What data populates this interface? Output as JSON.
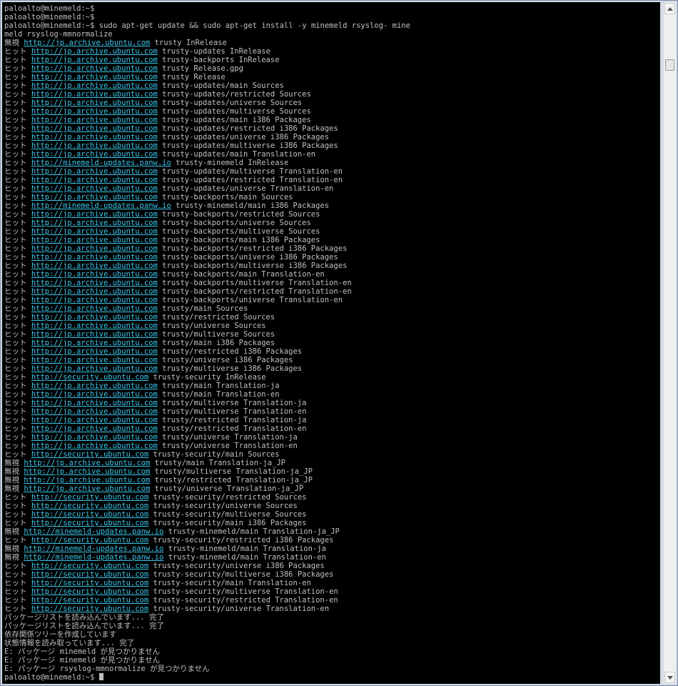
{
  "colors": {
    "background": "#000000",
    "text": "#c0c0c0",
    "link": "#39c6ea"
  },
  "terminal": {
    "lines": [
      {
        "text": "paloalto@minemeld:~$"
      },
      {
        "text": "paloalto@minemeld:~$"
      },
      {
        "text": "paloalto@minemeld:~$ sudo apt-get update && sudo apt-get install -y minemeld rsyslog- mine"
      },
      {
        "text": "meld rsyslog-mmnormalize"
      },
      {
        "pre": "無視 ",
        "url": "http://jp.archive.ubuntu.com",
        "post": " trusty InRelease"
      },
      {
        "pre": "ヒット ",
        "url": "http://jp.archive.ubuntu.com",
        "post": " trusty-updates InRelease"
      },
      {
        "pre": "ヒット ",
        "url": "http://jp.archive.ubuntu.com",
        "post": " trusty-backports InRelease"
      },
      {
        "pre": "ヒット ",
        "url": "http://jp.archive.ubuntu.com",
        "post": " trusty Release.gpg"
      },
      {
        "pre": "ヒット ",
        "url": "http://jp.archive.ubuntu.com",
        "post": " trusty Release"
      },
      {
        "pre": "ヒット ",
        "url": "http://jp.archive.ubuntu.com",
        "post": " trusty-updates/main Sources"
      },
      {
        "pre": "ヒット ",
        "url": "http://jp.archive.ubuntu.com",
        "post": " trusty-updates/restricted Sources"
      },
      {
        "pre": "ヒット ",
        "url": "http://jp.archive.ubuntu.com",
        "post": " trusty-updates/universe Sources"
      },
      {
        "pre": "ヒット ",
        "url": "http://jp.archive.ubuntu.com",
        "post": " trusty-updates/multiverse Sources"
      },
      {
        "pre": "ヒット ",
        "url": "http://jp.archive.ubuntu.com",
        "post": " trusty-updates/main i386 Packages"
      },
      {
        "pre": "ヒット ",
        "url": "http://jp.archive.ubuntu.com",
        "post": " trusty-updates/restricted i386 Packages"
      },
      {
        "pre": "ヒット ",
        "url": "http://jp.archive.ubuntu.com",
        "post": " trusty-updates/universe i386 Packages"
      },
      {
        "pre": "ヒット ",
        "url": "http://jp.archive.ubuntu.com",
        "post": " trusty-updates/multiverse i386 Packages"
      },
      {
        "pre": "ヒット ",
        "url": "http://jp.archive.ubuntu.com",
        "post": " trusty-updates/main Translation-en"
      },
      {
        "pre": "ヒット ",
        "url": "http://minemeld-updates.panw.io",
        "post": " trusty-minemeld InRelease"
      },
      {
        "pre": "ヒット ",
        "url": "http://jp.archive.ubuntu.com",
        "post": " trusty-updates/multiverse Translation-en"
      },
      {
        "pre": "ヒット ",
        "url": "http://jp.archive.ubuntu.com",
        "post": " trusty-updates/restricted Translation-en"
      },
      {
        "pre": "ヒット ",
        "url": "http://jp.archive.ubuntu.com",
        "post": " trusty-updates/universe Translation-en"
      },
      {
        "pre": "ヒット ",
        "url": "http://jp.archive.ubuntu.com",
        "post": " trusty-backports/main Sources"
      },
      {
        "pre": "ヒット ",
        "url": "http://minemeld-updates.panw.io",
        "post": " trusty-minemeld/main i386 Packages"
      },
      {
        "pre": "ヒット ",
        "url": "http://jp.archive.ubuntu.com",
        "post": " trusty-backports/restricted Sources"
      },
      {
        "pre": "ヒット ",
        "url": "http://jp.archive.ubuntu.com",
        "post": " trusty-backports/universe Sources"
      },
      {
        "pre": "ヒット ",
        "url": "http://jp.archive.ubuntu.com",
        "post": " trusty-backports/multiverse Sources"
      },
      {
        "pre": "ヒット ",
        "url": "http://jp.archive.ubuntu.com",
        "post": " trusty-backports/main i386 Packages"
      },
      {
        "pre": "ヒット ",
        "url": "http://jp.archive.ubuntu.com",
        "post": " trusty-backports/restricted i386 Packages"
      },
      {
        "pre": "ヒット ",
        "url": "http://jp.archive.ubuntu.com",
        "post": " trusty-backports/universe i386 Packages"
      },
      {
        "pre": "ヒット ",
        "url": "http://jp.archive.ubuntu.com",
        "post": " trusty-backports/multiverse i386 Packages"
      },
      {
        "pre": "ヒット ",
        "url": "http://jp.archive.ubuntu.com",
        "post": " trusty-backports/main Translation-en"
      },
      {
        "pre": "ヒット ",
        "url": "http://jp.archive.ubuntu.com",
        "post": " trusty-backports/multiverse Translation-en"
      },
      {
        "pre": "ヒット ",
        "url": "http://jp.archive.ubuntu.com",
        "post": " trusty-backports/restricted Translation-en"
      },
      {
        "pre": "ヒット ",
        "url": "http://jp.archive.ubuntu.com",
        "post": " trusty-backports/universe Translation-en"
      },
      {
        "pre": "ヒット ",
        "url": "http://jp.archive.ubuntu.com",
        "post": " trusty/main Sources"
      },
      {
        "pre": "ヒット ",
        "url": "http://jp.archive.ubuntu.com",
        "post": " trusty/restricted Sources"
      },
      {
        "pre": "ヒット ",
        "url": "http://jp.archive.ubuntu.com",
        "post": " trusty/universe Sources"
      },
      {
        "pre": "ヒット ",
        "url": "http://jp.archive.ubuntu.com",
        "post": " trusty/multiverse Sources"
      },
      {
        "pre": "ヒット ",
        "url": "http://jp.archive.ubuntu.com",
        "post": " trusty/main i386 Packages"
      },
      {
        "pre": "ヒット ",
        "url": "http://jp.archive.ubuntu.com",
        "post": " trusty/restricted i386 Packages"
      },
      {
        "pre": "ヒット ",
        "url": "http://jp.archive.ubuntu.com",
        "post": " trusty/universe i386 Packages"
      },
      {
        "pre": "ヒット ",
        "url": "http://jp.archive.ubuntu.com",
        "post": " trusty/multiverse i386 Packages"
      },
      {
        "pre": "ヒット ",
        "url": "http://security.ubuntu.com",
        "post": " trusty-security InRelease"
      },
      {
        "pre": "ヒット ",
        "url": "http://jp.archive.ubuntu.com",
        "post": " trusty/main Translation-ja"
      },
      {
        "pre": "ヒット ",
        "url": "http://jp.archive.ubuntu.com",
        "post": " trusty/main Translation-en"
      },
      {
        "pre": "ヒット ",
        "url": "http://jp.archive.ubuntu.com",
        "post": " trusty/multiverse Translation-ja"
      },
      {
        "pre": "ヒット ",
        "url": "http://jp.archive.ubuntu.com",
        "post": " trusty/multiverse Translation-en"
      },
      {
        "pre": "ヒット ",
        "url": "http://jp.archive.ubuntu.com",
        "post": " trusty/restricted Translation-ja"
      },
      {
        "pre": "ヒット ",
        "url": "http://jp.archive.ubuntu.com",
        "post": " trusty/restricted Translation-en"
      },
      {
        "pre": "ヒット ",
        "url": "http://jp.archive.ubuntu.com",
        "post": " trusty/universe Translation-ja"
      },
      {
        "pre": "ヒット ",
        "url": "http://jp.archive.ubuntu.com",
        "post": " trusty/universe Translation-en"
      },
      {
        "pre": "ヒット ",
        "url": "http://security.ubuntu.com",
        "post": " trusty-security/main Sources"
      },
      {
        "pre": "無視 ",
        "url": "http://jp.archive.ubuntu.com",
        "post": " trusty/main Translation-ja_JP"
      },
      {
        "pre": "無視 ",
        "url": "http://jp.archive.ubuntu.com",
        "post": " trusty/multiverse Translation-ja_JP"
      },
      {
        "pre": "無視 ",
        "url": "http://jp.archive.ubuntu.com",
        "post": " trusty/restricted Translation-ja_JP"
      },
      {
        "pre": "無視 ",
        "url": "http://jp.archive.ubuntu.com",
        "post": " trusty/universe Translation-ja_JP"
      },
      {
        "pre": "ヒット ",
        "url": "http://security.ubuntu.com",
        "post": " trusty-security/restricted Sources"
      },
      {
        "pre": "ヒット ",
        "url": "http://security.ubuntu.com",
        "post": " trusty-security/universe Sources"
      },
      {
        "pre": "ヒット ",
        "url": "http://security.ubuntu.com",
        "post": " trusty-security/multiverse Sources"
      },
      {
        "pre": "ヒット ",
        "url": "http://security.ubuntu.com",
        "post": " trusty-security/main i386 Packages"
      },
      {
        "pre": "無視 ",
        "url": "http://minemeld-updates.panw.io",
        "post": " trusty-minemeld/main Translation-ja_JP"
      },
      {
        "pre": "ヒット ",
        "url": "http://security.ubuntu.com",
        "post": " trusty-security/restricted i386 Packages"
      },
      {
        "pre": "無視 ",
        "url": "http://minemeld-updates.panw.io",
        "post": " trusty-minemeld/main Translation-ja"
      },
      {
        "pre": "無視 ",
        "url": "http://minemeld-updates.panw.io",
        "post": " trusty-minemeld/main Translation-en"
      },
      {
        "pre": "ヒット ",
        "url": "http://security.ubuntu.com",
        "post": " trusty-security/universe i386 Packages"
      },
      {
        "pre": "ヒット ",
        "url": "http://security.ubuntu.com",
        "post": " trusty-security/multiverse i386 Packages"
      },
      {
        "pre": "ヒット ",
        "url": "http://security.ubuntu.com",
        "post": " trusty-security/main Translation-en"
      },
      {
        "pre": "ヒット ",
        "url": "http://security.ubuntu.com",
        "post": " trusty-security/multiverse Translation-en"
      },
      {
        "pre": "ヒット ",
        "url": "http://security.ubuntu.com",
        "post": " trusty-security/restricted Translation-en"
      },
      {
        "pre": "ヒット ",
        "url": "http://security.ubuntu.com",
        "post": " trusty-security/universe Translation-en"
      },
      {
        "text": "パッケージリストを読み込んでいます... 完了"
      },
      {
        "text": "パッケージリストを読み込んでいます... 完了"
      },
      {
        "text": "依存関係ツリーを作成しています"
      },
      {
        "text": "状態情報を読み取っています... 完了"
      },
      {
        "text": "E: パッケージ minemeld が見つかりません"
      },
      {
        "text": "E: パッケージ minemeld が見つかりません"
      },
      {
        "text": "E: パッケージ rsyslog-mmnormalize が見つかりません"
      },
      {
        "text": "paloalto@minemeld:~$ ",
        "cursor": true
      }
    ]
  }
}
